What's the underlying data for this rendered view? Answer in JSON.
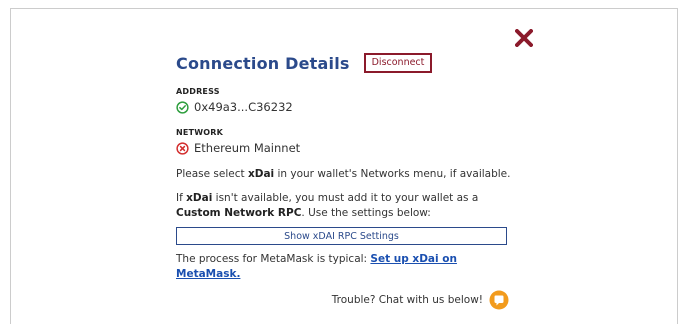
{
  "header": {
    "title": "Connection Details",
    "disconnect_label": "Disconnect"
  },
  "address": {
    "label": "ADDRESS",
    "value": "0x49a3...C36232",
    "status_icon": "check-circle-icon"
  },
  "network": {
    "label": "NETWORK",
    "value": "Ethereum Mainnet",
    "status_icon": "x-circle-icon"
  },
  "instructions": {
    "select_pre": "Please select ",
    "select_bold": "xDai",
    "select_post": " in your wallet's Networks menu, if available.",
    "if_pre": "If ",
    "if_bold": "xDai",
    "if_post": " isn't available, you must add it to your wallet as a",
    "custom_bold": "Custom Network RPC",
    "custom_post": ". Use the settings below:"
  },
  "rpc_button_label": "Show xDAI RPC Settings",
  "metamask": {
    "text": "The process for MetaMask is typical: ",
    "link": "Set up xDai on MetaMask."
  },
  "trouble_text": "Trouble? Chat with us below!",
  "colors": {
    "title": "#2b4a8b",
    "disconnect": "#8b1a2b",
    "close": "#8b1a2b",
    "success": "#2e9e3e",
    "error": "#d32f2f",
    "chat": "#f29b1d",
    "link": "#1a4fb0"
  }
}
